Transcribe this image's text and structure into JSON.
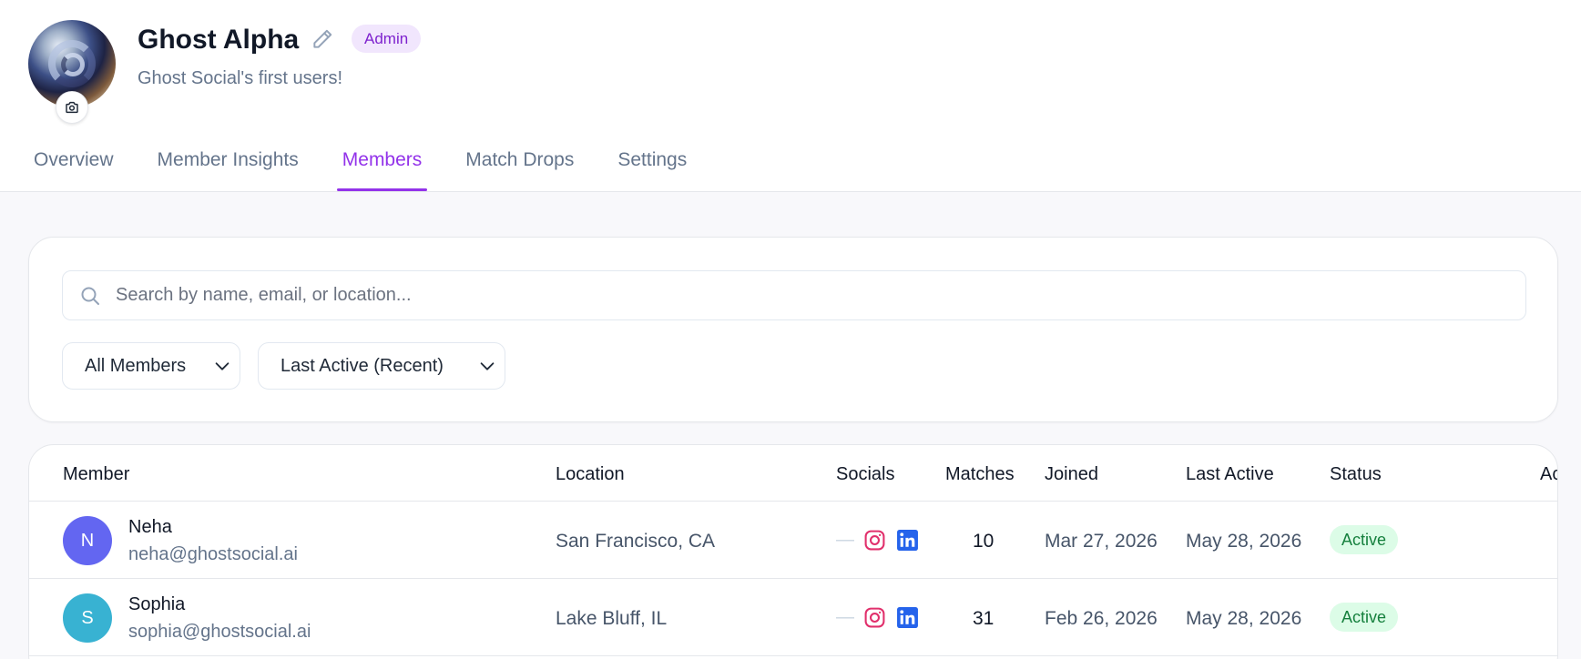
{
  "group": {
    "title": "Ghost Alpha",
    "role_badge": "Admin",
    "subtitle": "Ghost Social's first users!"
  },
  "tabs": [
    {
      "label": "Overview",
      "active": false
    },
    {
      "label": "Member Insights",
      "active": false
    },
    {
      "label": "Members",
      "active": true
    },
    {
      "label": "Match Drops",
      "active": false
    },
    {
      "label": "Settings",
      "active": false
    }
  ],
  "filters": {
    "search_placeholder": "Search by name, email, or location...",
    "member_filter": "All Members",
    "sort_order": "Last Active (Recent)"
  },
  "table": {
    "columns": [
      "Member",
      "Location",
      "Socials",
      "Matches",
      "Joined",
      "Last Active",
      "Status",
      "Ac"
    ],
    "rows": [
      {
        "initial": "N",
        "avatar_color": "#6366f1",
        "name": "Neha",
        "email": "neha@ghostsocial.ai",
        "location": "San Francisco, CA",
        "socials_empty": "—",
        "matches": "10",
        "joined": "Mar 27, 2026",
        "last_active": "May 28, 2026",
        "status": "Active"
      },
      {
        "initial": "S",
        "avatar_color": "#38b2d2",
        "name": "Sophia",
        "email": "sophia@ghostsocial.ai",
        "location": "Lake Bluff, IL",
        "socials_empty": "—",
        "matches": "31",
        "joined": "Feb 26, 2026",
        "last_active": "May 28, 2026",
        "status": "Active"
      }
    ]
  },
  "colors": {
    "accent": "#9333ea",
    "badge_bg": "#f1e6fd",
    "status_active_bg": "#dcfce7",
    "status_active_text": "#15803d",
    "instagram": "#e1306c",
    "linkedin": "#2563eb"
  }
}
